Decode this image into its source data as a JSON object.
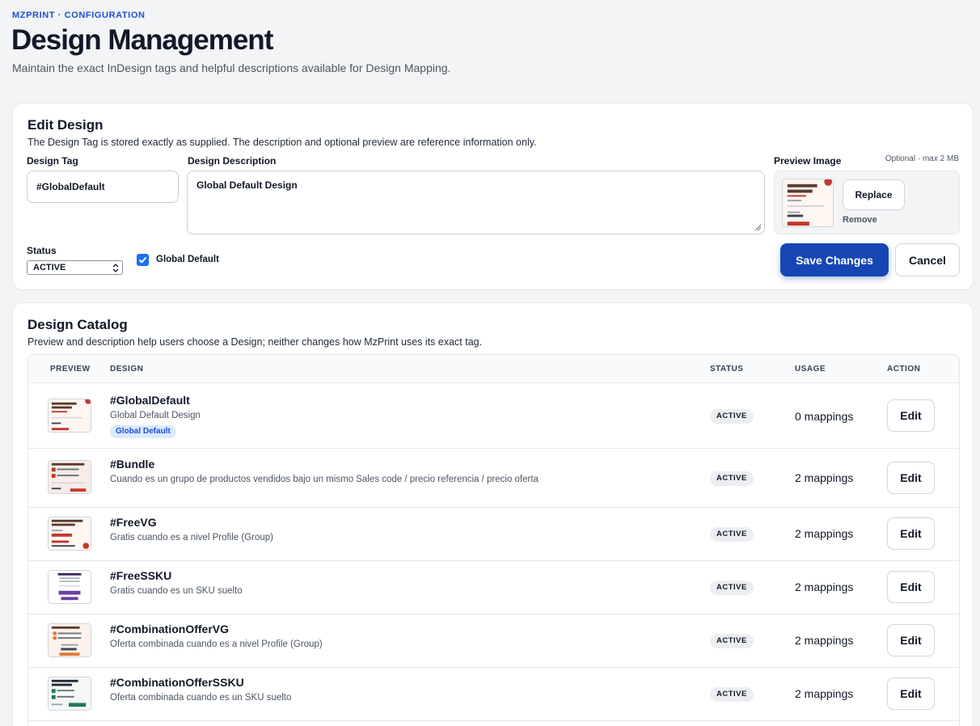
{
  "header": {
    "breadcrumb": "MZPRINT · CONFIGURATION",
    "title": "Design Management",
    "subtitle": "Maintain the exact InDesign tags and helpful descriptions available for Design Mapping."
  },
  "edit_design": {
    "title": "Edit Design",
    "description": "The Design Tag is stored exactly as supplied. The description and optional preview are reference information only.",
    "tag_label": "Design Tag",
    "tag_value": "#GlobalDefault",
    "desc_label": "Design Description",
    "desc_value": "Global Default Design",
    "preview_label": "Preview Image",
    "preview_note": "Optional · max 2 MB",
    "replace_label": "Replace",
    "remove_label": "Remove",
    "status_label": "Status",
    "status_value": "ACTIVE",
    "global_default_label": "Global Default",
    "global_default_checked": true,
    "save_label": "Save Changes",
    "cancel_label": "Cancel",
    "accent_color": "#1546b3"
  },
  "catalog": {
    "title": "Design Catalog",
    "description": "Preview and description help users choose a Design; neither changes how MzPrint uses its exact tag.",
    "columns": [
      "PREVIEW",
      "DESIGN",
      "STATUS",
      "USAGE",
      "ACTION"
    ],
    "rows": [
      {
        "tag": "#GlobalDefault",
        "description": "Global Default Design",
        "badge": "Global Default",
        "status": "ACTIVE",
        "usage": "0 mappings",
        "action": "Edit"
      },
      {
        "tag": "#Bundle",
        "description": "Cuando es un grupo de productos vendidos bajo un mismo Sales code / precio referencia / precio oferta",
        "status": "ACTIVE",
        "usage": "2 mappings",
        "action": "Edit"
      },
      {
        "tag": "#FreeVG",
        "description": "Gratis cuando es a nivel Profile (Group)",
        "status": "ACTIVE",
        "usage": "2 mappings",
        "action": "Edit"
      },
      {
        "tag": "#FreeSSKU",
        "description": "Gratis cuando es un SKU suelto",
        "status": "ACTIVE",
        "usage": "2 mappings",
        "action": "Edit"
      },
      {
        "tag": "#CombinationOfferVG",
        "description": "Oferta combinada cuando es a nivel Profile (Group)",
        "status": "ACTIVE",
        "usage": "2 mappings",
        "action": "Edit"
      },
      {
        "tag": "#CombinationOfferSSKU",
        "description": "Oferta combinada cuando es un SKU suelto",
        "status": "ACTIVE",
        "usage": "2 mappings",
        "action": "Edit"
      }
    ]
  }
}
